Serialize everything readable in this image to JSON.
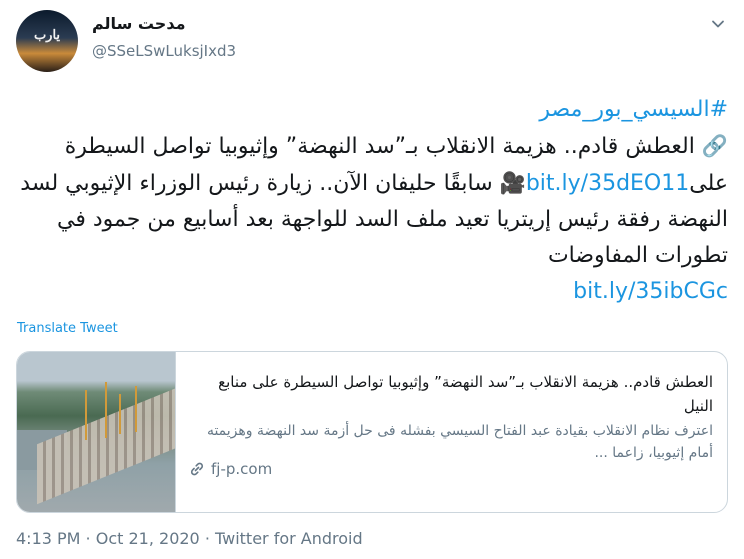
{
  "user": {
    "display_name": "مدحت سالم",
    "handle": "@SSeLSwLuksjIxd3",
    "avatar_text": "يارب"
  },
  "tweet": {
    "hashtag": "#السيسي_بور_مصر",
    "part1": "العطش قادم.. هزيمة الانقلاب بـ”سد النهضة” وإثيوبيا تواصل السيطرة على",
    "link1": "bit.ly/35dEO11",
    "part2": "سابقًا حليفان الآن.. زيارة رئيس الوزراء الإثيوبي لسد النهضة رفقة رئيس إريتريا تعيد ملف السد للواجهة بعد أسابيع من جمود في تطورات المفاوضات",
    "link2": "bit.ly/35ibCGc"
  },
  "translate_label": "Translate Tweet",
  "card": {
    "title": "العطش قادم.. هزيمة الانقلاب بـ”سد النهضة” وإثيوبيا تواصل السيطرة على منابع النيل",
    "description": "اعترف نظام الانقلاب بقيادة عبد الفتاح السيسي بفشله فى حل أزمة سد النهضة وهزيمته أمام إثيوبيا، زاعما ...",
    "domain": "fj-p.com"
  },
  "meta": {
    "text": "4:13 PM · Oct 21, 2020 · Twitter for Android"
  },
  "icons": {
    "link_icon": "link-icon",
    "camera_icon": "movie-camera-icon",
    "caret_icon": "chevron-down-icon"
  },
  "colors": {
    "link": "#1b95e0",
    "secondary": "#657786",
    "border": "#ccd6dd"
  }
}
